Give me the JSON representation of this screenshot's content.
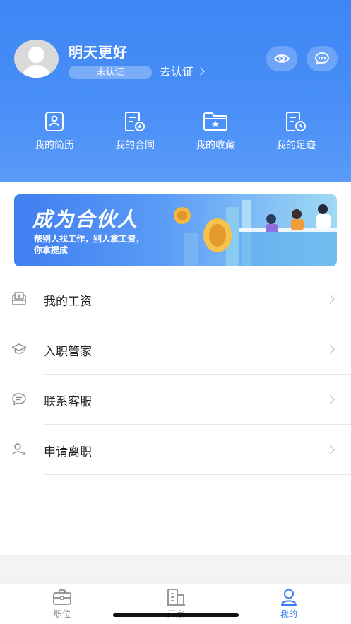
{
  "profile": {
    "name": "明天更好",
    "status_badge": "未认证",
    "verify_link": "去认证"
  },
  "shortcuts": [
    {
      "label": "我的简历",
      "icon": "resume-icon"
    },
    {
      "label": "我的合同",
      "icon": "contract-icon"
    },
    {
      "label": "我的收藏",
      "icon": "favorites-folder-icon"
    },
    {
      "label": "我的足迹",
      "icon": "history-icon"
    }
  ],
  "banner": {
    "title": "成为合伙人",
    "line1": "帮别人找工作，别人拿工资，",
    "line2": "你拿提成"
  },
  "menu": [
    {
      "label": "我的工资",
      "icon": "salary-icon"
    },
    {
      "label": "入职管家",
      "icon": "graduation-cap-icon"
    },
    {
      "label": "联系客服",
      "icon": "chat-bubble-icon"
    },
    {
      "label": "申请离职",
      "icon": "user-remove-icon"
    }
  ],
  "tabs": [
    {
      "label": "职位",
      "icon": "briefcase-icon",
      "active": false
    },
    {
      "label": "厂家",
      "icon": "building-icon",
      "active": false
    },
    {
      "label": "我的",
      "icon": "person-icon",
      "active": true
    }
  ],
  "colors": {
    "primary": "#3e86f5",
    "active_tab": "#3a7ef0"
  }
}
